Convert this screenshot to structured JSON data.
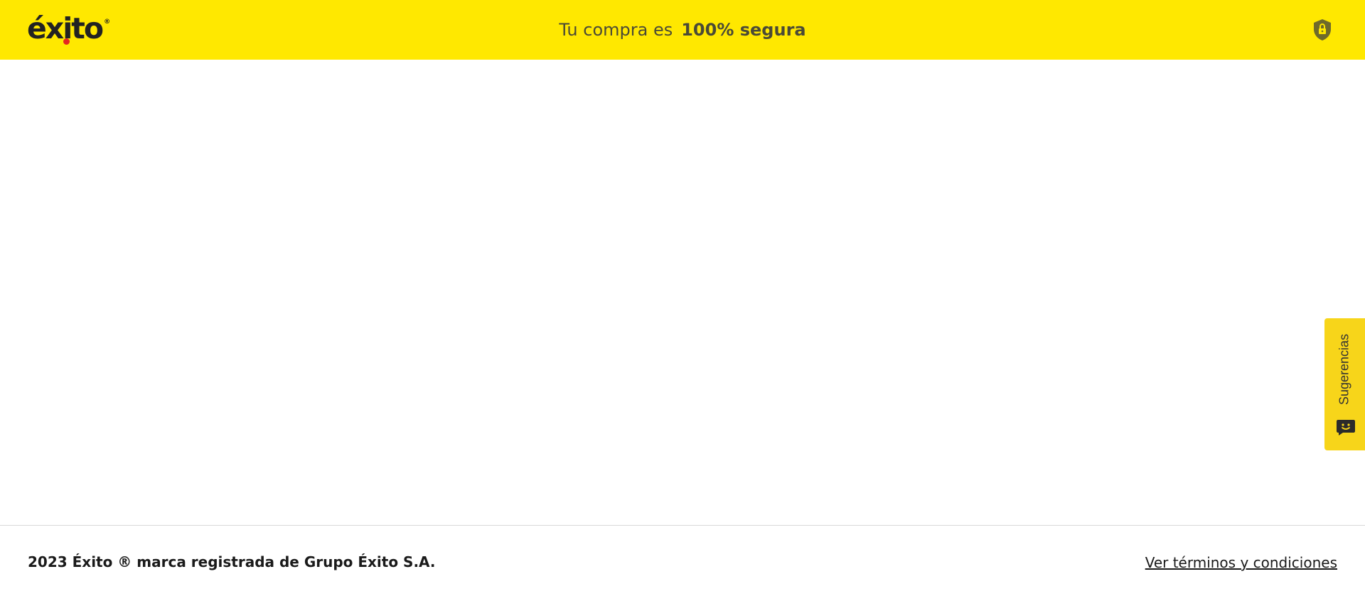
{
  "header": {
    "logo_text": "éxito",
    "logo_registered": "®",
    "secure_prefix": "Tu compra es",
    "secure_emphasis": "100% segura",
    "shield_icon": "shield-lock-icon",
    "background_color": "#ffe800"
  },
  "feedback": {
    "label": "Sugerencias",
    "icon": "chat-bot-icon",
    "background_color": "#f7d51a"
  },
  "footer": {
    "copyright": "2023 Éxito ® marca registrada de Grupo Éxito S.A.",
    "terms_link": "Ver términos y condiciones"
  }
}
